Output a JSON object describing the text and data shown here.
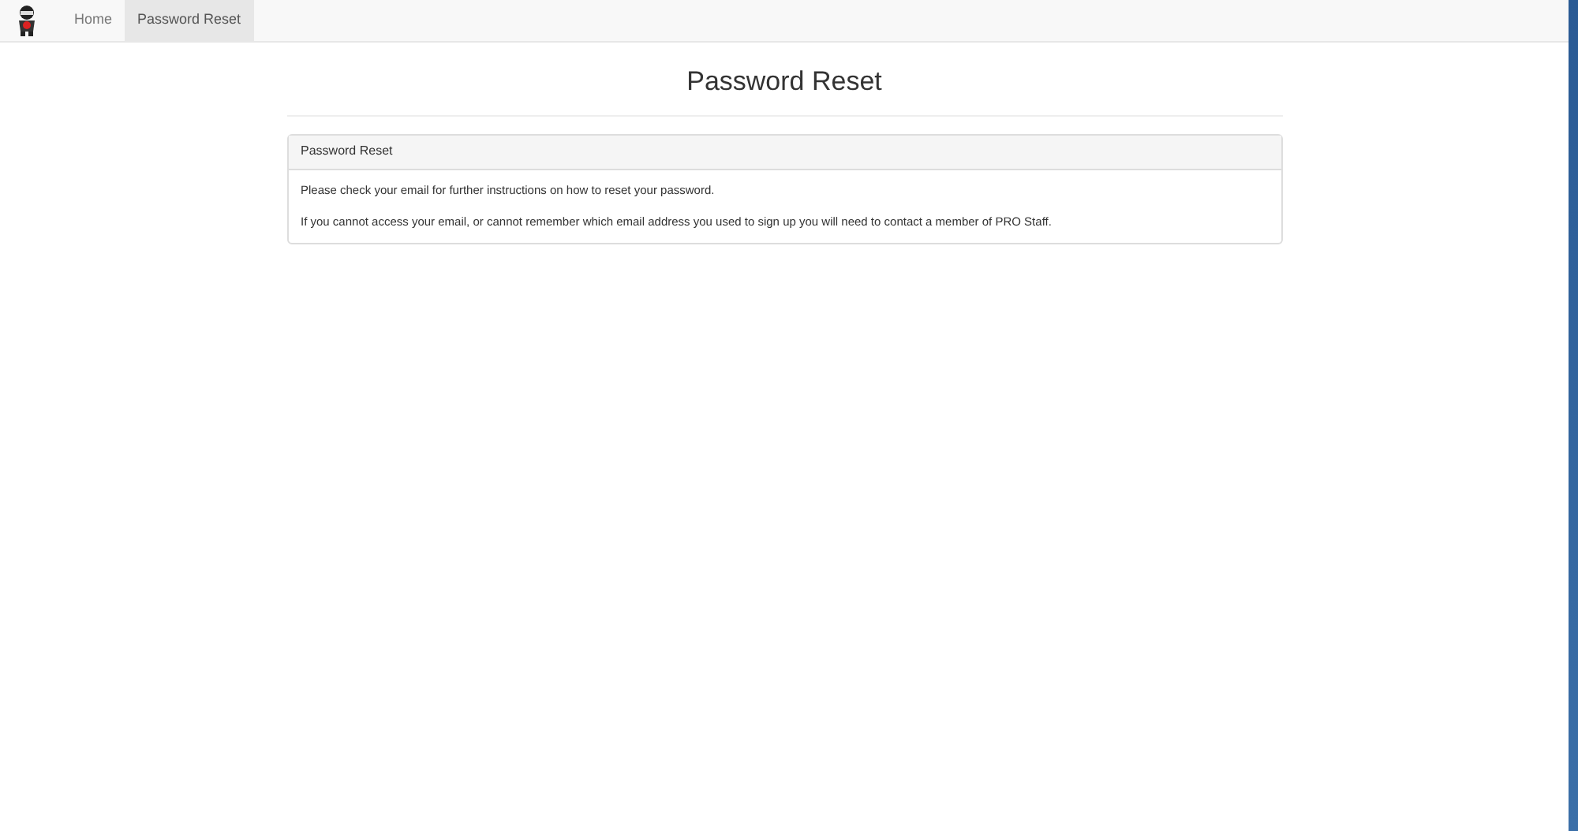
{
  "navbar": {
    "items": [
      {
        "label": "Home",
        "selected": false
      },
      {
        "label": "Password Reset",
        "selected": true
      }
    ]
  },
  "page_title": "Password Reset",
  "panel": {
    "heading": "Password Reset",
    "paragraphs": [
      "Please check your email for further instructions on how to reset your password.",
      "If you cannot access your email, or cannot remember which email address you used to sign up you will need to contact a member of PRO Staff."
    ]
  }
}
